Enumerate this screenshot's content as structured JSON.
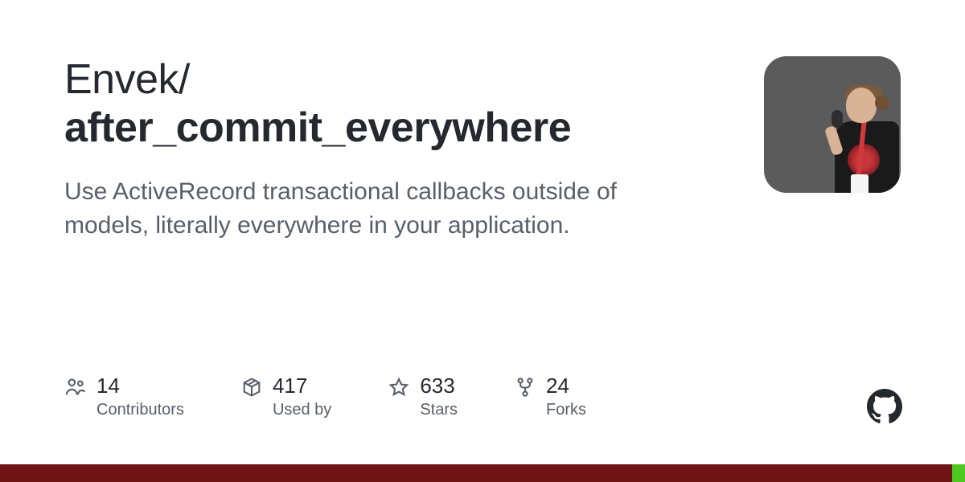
{
  "owner": "Envek",
  "slash": "/",
  "repo": "after_commit_everywhere",
  "description": "Use ActiveRecord transactional callbacks outside of models, literally everywhere in your application.",
  "stats": {
    "contributors": {
      "value": "14",
      "label": "Contributors"
    },
    "usedby": {
      "value": "417",
      "label": "Used by"
    },
    "stars": {
      "value": "633",
      "label": "Stars"
    },
    "forks": {
      "value": "24",
      "label": "Forks"
    }
  }
}
